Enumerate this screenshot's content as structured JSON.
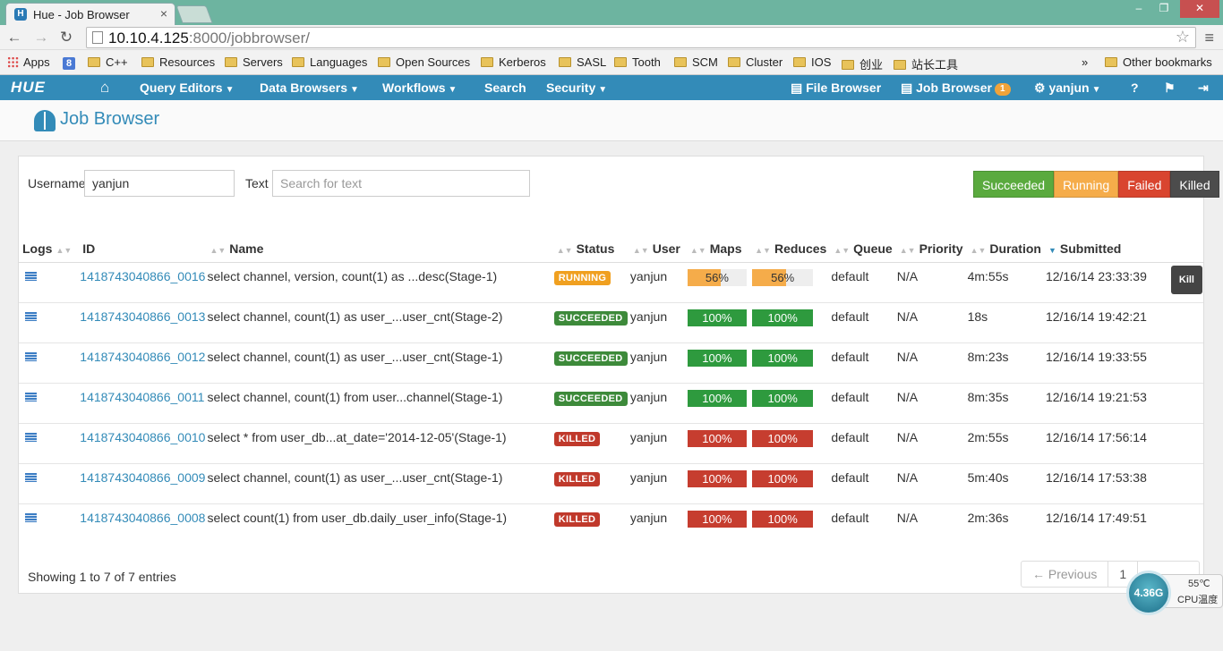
{
  "browser": {
    "tab_title": "Hue - Job Browser",
    "tab_close": "×",
    "url_host": "10.10.4.125",
    "url_rest": ":8000/jobbrowser/",
    "window_controls": [
      "–",
      "❐",
      "✕"
    ],
    "bookmarks": [
      "Apps",
      "C++",
      "Resources",
      "Servers",
      "Languages",
      "Open Sources",
      "Kerberos",
      "SASL",
      "Tooth",
      "SCM",
      "Cluster",
      "IOS",
      "创业",
      "站长工具"
    ],
    "bookmarks_more": "»",
    "other_bookmarks": "Other bookmarks"
  },
  "huebar": {
    "logo": "HUE",
    "query_editors": "Query Editors",
    "data_browsers": "Data Browsers",
    "workflows": "Workflows",
    "search": "Search",
    "security": "Security",
    "file_browser": "File Browser",
    "job_browser": "Job Browser",
    "job_count": "1",
    "user": "yanjun"
  },
  "page": {
    "title": "Job Browser"
  },
  "filters": {
    "username_label": "Username",
    "username_value": "yanjun",
    "text_label": "Text",
    "text_placeholder": "Search for text",
    "buttons": [
      {
        "label": "Succeeded",
        "color": "#5aaa3e"
      },
      {
        "label": "Running",
        "color": "#f5ac4a"
      },
      {
        "label": "Failed",
        "color": "#d9452f"
      },
      {
        "label": "Killed",
        "color": "#4c4c4c"
      }
    ]
  },
  "table": {
    "columns": [
      "Logs",
      "ID",
      "Name",
      "Status",
      "User",
      "Maps",
      "Reduces",
      "Queue",
      "Priority",
      "Duration",
      "Submitted"
    ],
    "rows": [
      {
        "id": "1418743040866_0016",
        "name": "select channel, version, count(1) as ...desc(Stage-1)",
        "status": "RUNNING",
        "user": "yanjun",
        "maps": "56%",
        "reduces": "56%",
        "queue": "default",
        "priority": "N/A",
        "duration": "4m:55s",
        "submitted": "12/16/14 23:33:39",
        "action": "Kill"
      },
      {
        "id": "1418743040866_0013",
        "name": "select channel, count(1) as user_...user_cnt(Stage-2)",
        "status": "SUCCEEDED",
        "user": "yanjun",
        "maps": "100%",
        "reduces": "100%",
        "queue": "default",
        "priority": "N/A",
        "duration": "18s",
        "submitted": "12/16/14 19:42:21"
      },
      {
        "id": "1418743040866_0012",
        "name": "select channel, count(1) as user_...user_cnt(Stage-1)",
        "status": "SUCCEEDED",
        "user": "yanjun",
        "maps": "100%",
        "reduces": "100%",
        "queue": "default",
        "priority": "N/A",
        "duration": "8m:23s",
        "submitted": "12/16/14 19:33:55"
      },
      {
        "id": "1418743040866_0011",
        "name": "select channel, count(1) from user...channel(Stage-1)",
        "status": "SUCCEEDED",
        "user": "yanjun",
        "maps": "100%",
        "reduces": "100%",
        "queue": "default",
        "priority": "N/A",
        "duration": "8m:35s",
        "submitted": "12/16/14 19:21:53"
      },
      {
        "id": "1418743040866_0010",
        "name": "select * from user_db...at_date='2014-12-05'(Stage-1)",
        "status": "KILLED",
        "user": "yanjun",
        "maps": "100%",
        "reduces": "100%",
        "queue": "default",
        "priority": "N/A",
        "duration": "2m:55s",
        "submitted": "12/16/14 17:56:14"
      },
      {
        "id": "1418743040866_0009",
        "name": "select channel, count(1) as user_...user_cnt(Stage-1)",
        "status": "KILLED",
        "user": "yanjun",
        "maps": "100%",
        "reduces": "100%",
        "queue": "default",
        "priority": "N/A",
        "duration": "5m:40s",
        "submitted": "12/16/14 17:53:38"
      },
      {
        "id": "1418743040866_0008",
        "name": "select count(1) from user_db.daily_user_info(Stage-1)",
        "status": "KILLED",
        "user": "yanjun",
        "maps": "100%",
        "reduces": "100%",
        "queue": "default",
        "priority": "N/A",
        "duration": "2m:36s",
        "submitted": "12/16/14 17:49:51"
      }
    ]
  },
  "status_colors": {
    "RUNNING": "#f0a020",
    "SUCCEEDED": "#3d8a3a",
    "KILLED": "#c0392b"
  },
  "bar_colors": {
    "RUNNING": "#f5ac4a",
    "SUCCEEDED": "#2e9a3e",
    "KILLED": "#c63d2f"
  },
  "footer": {
    "showing": "Showing 1 to 7 of 7 entries",
    "previous": "← Previous",
    "page": "1",
    "next": ""
  },
  "cpu_widget": {
    "gauge": "4.36G",
    "temp": "55℃",
    "label": "CPU温度"
  }
}
